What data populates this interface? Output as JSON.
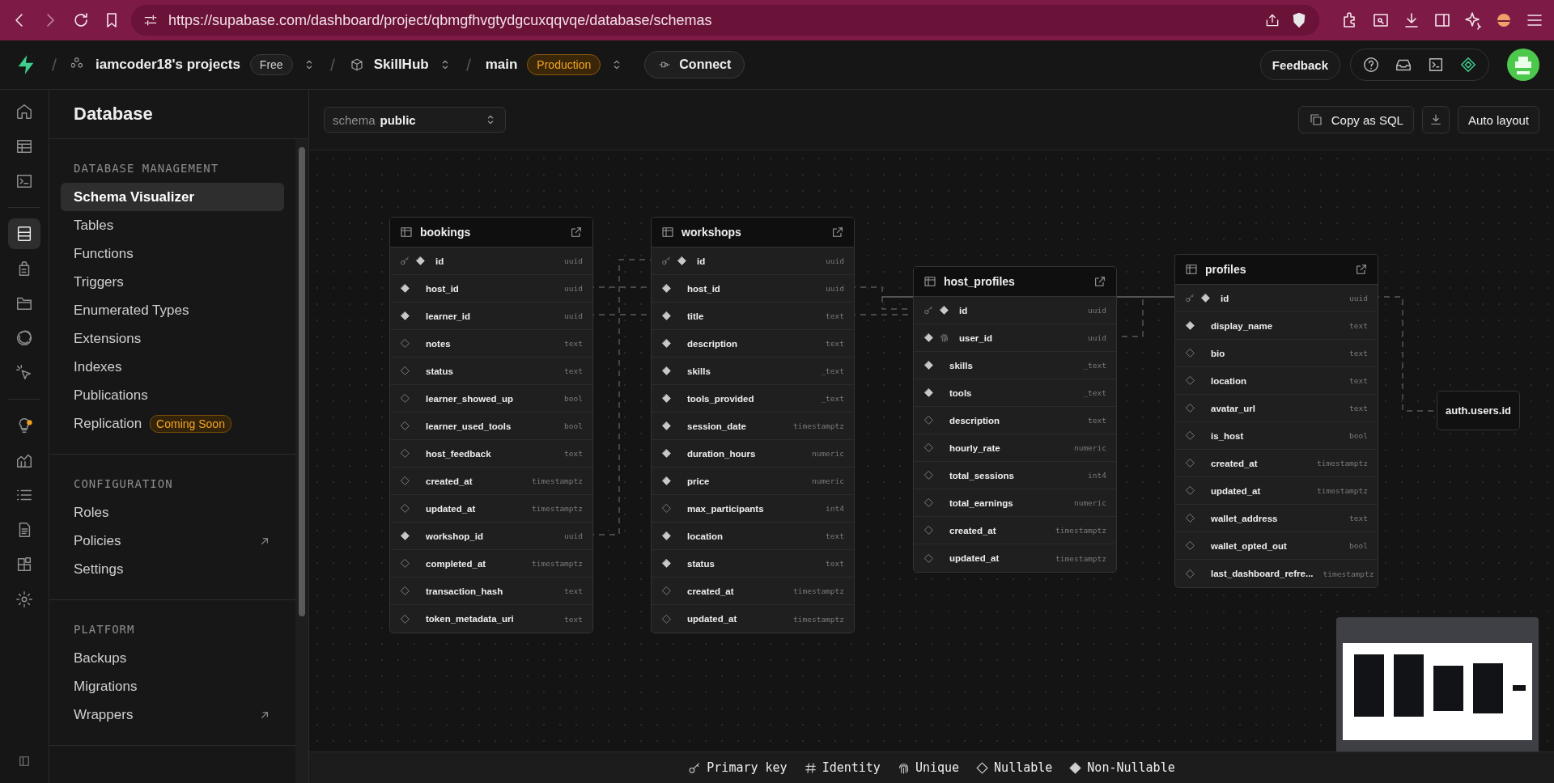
{
  "browser": {
    "url": "https://supabase.com/dashboard/project/qbmgfhvgtydgcuxqqvqe/database/schemas"
  },
  "header": {
    "org": "iamcoder18's projects",
    "plan": "Free",
    "project": "SkillHub",
    "branch": "main",
    "environment": "Production",
    "connect": "Connect",
    "feedback": "Feedback"
  },
  "rail": {
    "groups": [
      [
        {
          "kind": "home",
          "selected": false
        },
        {
          "kind": "table",
          "selected": false
        },
        {
          "kind": "terminal",
          "selected": false
        }
      ],
      [
        {
          "kind": "database",
          "selected": true
        },
        {
          "kind": "lock",
          "selected": false
        },
        {
          "kind": "folder",
          "selected": false
        },
        {
          "kind": "realtime",
          "selected": false
        },
        {
          "kind": "cursor",
          "selected": false
        }
      ],
      [
        {
          "kind": "bulb",
          "selected": false,
          "notification": true
        },
        {
          "kind": "chart",
          "selected": false
        },
        {
          "kind": "list",
          "selected": false
        },
        {
          "kind": "doc",
          "selected": false
        },
        {
          "kind": "blocks",
          "selected": false
        },
        {
          "kind": "gear",
          "selected": false
        }
      ]
    ]
  },
  "sidebar": {
    "title": "Database",
    "sections": [
      {
        "heading": "DATABASE MANAGEMENT",
        "items": [
          {
            "label": "Schema Visualizer",
            "selected": true,
            "external": false
          },
          {
            "label": "Tables",
            "selected": false,
            "external": false
          },
          {
            "label": "Functions",
            "selected": false,
            "external": false
          },
          {
            "label": "Triggers",
            "selected": false,
            "external": false
          },
          {
            "label": "Enumerated Types",
            "selected": false,
            "external": false
          },
          {
            "label": "Extensions",
            "selected": false,
            "external": false
          },
          {
            "label": "Indexes",
            "selected": false,
            "external": false
          },
          {
            "label": "Publications",
            "selected": false,
            "external": false
          },
          {
            "label": "Replication",
            "selected": false,
            "external": false,
            "badge": "Coming Soon"
          }
        ]
      },
      {
        "heading": "CONFIGURATION",
        "items": [
          {
            "label": "Roles",
            "selected": false,
            "external": false
          },
          {
            "label": "Policies",
            "selected": false,
            "external": true
          },
          {
            "label": "Settings",
            "selected": false,
            "external": false
          }
        ]
      },
      {
        "heading": "PLATFORM",
        "items": [
          {
            "label": "Backups",
            "selected": false,
            "external": false
          },
          {
            "label": "Migrations",
            "selected": false,
            "external": false
          },
          {
            "label": "Wrappers",
            "selected": false,
            "external": true
          }
        ]
      }
    ]
  },
  "toolbar": {
    "schema_label": "schema",
    "schema": "public",
    "copy": "Copy as SQL",
    "auto_layout": "Auto layout"
  },
  "tables": [
    {
      "name": "bookings",
      "columns": [
        {
          "name": "id",
          "type": "uuid",
          "primary_key": true,
          "unique": false,
          "nullable": false
        },
        {
          "name": "host_id",
          "type": "uuid",
          "primary_key": false,
          "unique": false,
          "nullable": false
        },
        {
          "name": "learner_id",
          "type": "uuid",
          "primary_key": false,
          "unique": false,
          "nullable": false
        },
        {
          "name": "notes",
          "type": "text",
          "primary_key": false,
          "unique": false,
          "nullable": true
        },
        {
          "name": "status",
          "type": "text",
          "primary_key": false,
          "unique": false,
          "nullable": true
        },
        {
          "name": "learner_showed_up",
          "type": "bool",
          "primary_key": false,
          "unique": false,
          "nullable": true
        },
        {
          "name": "learner_used_tools",
          "type": "bool",
          "primary_key": false,
          "unique": false,
          "nullable": true
        },
        {
          "name": "host_feedback",
          "type": "text",
          "primary_key": false,
          "unique": false,
          "nullable": true
        },
        {
          "name": "created_at",
          "type": "timestamptz",
          "primary_key": false,
          "unique": false,
          "nullable": true
        },
        {
          "name": "updated_at",
          "type": "timestamptz",
          "primary_key": false,
          "unique": false,
          "nullable": true
        },
        {
          "name": "workshop_id",
          "type": "uuid",
          "primary_key": false,
          "unique": false,
          "nullable": false
        },
        {
          "name": "completed_at",
          "type": "timestamptz",
          "primary_key": false,
          "unique": false,
          "nullable": true
        },
        {
          "name": "transaction_hash",
          "type": "text",
          "primary_key": false,
          "unique": false,
          "nullable": true
        },
        {
          "name": "token_metadata_uri",
          "type": "text",
          "primary_key": false,
          "unique": false,
          "nullable": true
        }
      ]
    },
    {
      "name": "workshops",
      "columns": [
        {
          "name": "id",
          "type": "uuid",
          "primary_key": true,
          "unique": false,
          "nullable": false
        },
        {
          "name": "host_id",
          "type": "uuid",
          "primary_key": false,
          "unique": false,
          "nullable": false
        },
        {
          "name": "title",
          "type": "text",
          "primary_key": false,
          "unique": false,
          "nullable": false
        },
        {
          "name": "description",
          "type": "text",
          "primary_key": false,
          "unique": false,
          "nullable": false
        },
        {
          "name": "skills",
          "type": "_text",
          "primary_key": false,
          "unique": false,
          "nullable": false
        },
        {
          "name": "tools_provided",
          "type": "_text",
          "primary_key": false,
          "unique": false,
          "nullable": false
        },
        {
          "name": "session_date",
          "type": "timestamptz",
          "primary_key": false,
          "unique": false,
          "nullable": false
        },
        {
          "name": "duration_hours",
          "type": "numeric",
          "primary_key": false,
          "unique": false,
          "nullable": false
        },
        {
          "name": "price",
          "type": "numeric",
          "primary_key": false,
          "unique": false,
          "nullable": false
        },
        {
          "name": "max_participants",
          "type": "int4",
          "primary_key": false,
          "unique": false,
          "nullable": true
        },
        {
          "name": "location",
          "type": "text",
          "primary_key": false,
          "unique": false,
          "nullable": false
        },
        {
          "name": "status",
          "type": "text",
          "primary_key": false,
          "unique": false,
          "nullable": false
        },
        {
          "name": "created_at",
          "type": "timestamptz",
          "primary_key": false,
          "unique": false,
          "nullable": true
        },
        {
          "name": "updated_at",
          "type": "timestamptz",
          "primary_key": false,
          "unique": false,
          "nullable": true
        }
      ]
    },
    {
      "name": "host_profiles",
      "columns": [
        {
          "name": "id",
          "type": "uuid",
          "primary_key": true,
          "unique": false,
          "nullable": false
        },
        {
          "name": "user_id",
          "type": "uuid",
          "primary_key": false,
          "unique": true,
          "nullable": false
        },
        {
          "name": "skills",
          "type": "_text",
          "primary_key": false,
          "unique": false,
          "nullable": false
        },
        {
          "name": "tools",
          "type": "_text",
          "primary_key": false,
          "unique": false,
          "nullable": false
        },
        {
          "name": "description",
          "type": "text",
          "primary_key": false,
          "unique": false,
          "nullable": true
        },
        {
          "name": "hourly_rate",
          "type": "numeric",
          "primary_key": false,
          "unique": false,
          "nullable": true
        },
        {
          "name": "total_sessions",
          "type": "int4",
          "primary_key": false,
          "unique": false,
          "nullable": true
        },
        {
          "name": "total_earnings",
          "type": "numeric",
          "primary_key": false,
          "unique": false,
          "nullable": true
        },
        {
          "name": "created_at",
          "type": "timestamptz",
          "primary_key": false,
          "unique": false,
          "nullable": true
        },
        {
          "name": "updated_at",
          "type": "timestamptz",
          "primary_key": false,
          "unique": false,
          "nullable": true
        }
      ]
    },
    {
      "name": "profiles",
      "columns": [
        {
          "name": "id",
          "type": "uuid",
          "primary_key": true,
          "unique": false,
          "nullable": false
        },
        {
          "name": "display_name",
          "type": "text",
          "primary_key": false,
          "unique": false,
          "nullable": false
        },
        {
          "name": "bio",
          "type": "text",
          "primary_key": false,
          "unique": false,
          "nullable": true
        },
        {
          "name": "location",
          "type": "text",
          "primary_key": false,
          "unique": false,
          "nullable": true
        },
        {
          "name": "avatar_url",
          "type": "text",
          "primary_key": false,
          "unique": false,
          "nullable": true
        },
        {
          "name": "is_host",
          "type": "bool",
          "primary_key": false,
          "unique": false,
          "nullable": true
        },
        {
          "name": "created_at",
          "type": "timestamptz",
          "primary_key": false,
          "unique": false,
          "nullable": true
        },
        {
          "name": "updated_at",
          "type": "timestamptz",
          "primary_key": false,
          "unique": false,
          "nullable": true
        },
        {
          "name": "wallet_address",
          "type": "text",
          "primary_key": false,
          "unique": false,
          "nullable": true
        },
        {
          "name": "wallet_opted_out",
          "type": "bool",
          "primary_key": false,
          "unique": false,
          "nullable": true
        },
        {
          "name": "last_dashboard_refre...",
          "type": "timestamptz",
          "primary_key": false,
          "unique": false,
          "nullable": true
        }
      ]
    }
  ],
  "auth_node": "auth.users.id",
  "legend": [
    {
      "kind": "primary_key",
      "label": "Primary key"
    },
    {
      "kind": "identity",
      "label": "Identity"
    },
    {
      "kind": "unique",
      "label": "Unique"
    },
    {
      "kind": "nullable",
      "label": "Nullable"
    },
    {
      "kind": "non_nullable",
      "label": "Non-Nullable"
    }
  ]
}
